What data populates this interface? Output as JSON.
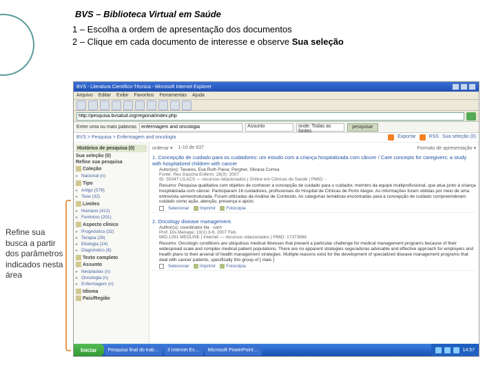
{
  "slide": {
    "title": "BVS – Biblioteca Virtual em Saúde",
    "line1": "1 – Escolha a ordem de apresentação dos documentos",
    "line2_a": "2 – Clique em cada documento de interesse e observe ",
    "line2_b": "Sua seleção"
  },
  "annotation": "Refine sua busca a partir dos parâmetros indicados nesta área",
  "browser": {
    "title": "BVS - Literatura Científico-Técnica - Microsoft Internet Explorer",
    "menu": [
      "Arquivo",
      "Editar",
      "Exibir",
      "Favoritos",
      "Ferramentas",
      "Ajuda"
    ],
    "address": "http://pesquisa.bvsalud.org/regional/index.php",
    "go": "Ir",
    "search": {
      "label": "Entre uma ou mais palavras",
      "value": "enfermagem and oncologia",
      "field": "Assunto",
      "scope": "onde: Todas as fontes",
      "button": "pesquisar"
    },
    "breadcrumb": "BVS > Pesquisa > Enfermagem and oncologia",
    "export": "Exportar",
    "rss": "RSS",
    "selection": "Sua seleção (0)"
  },
  "sidebar": {
    "history": "Histórico de pesquisa (0)",
    "yoursel": "Sua seleção (0)",
    "refine": "Refine sua pesquisa",
    "sections": [
      {
        "h": "Coleção",
        "items": [
          "Nacional (n)"
        ]
      },
      {
        "h": "Tipo",
        "items": [
          "Artigo (579)",
          "Tese (32)"
        ]
      },
      {
        "h": "Limites",
        "items": [
          "Humano (412)",
          "Feminino (201)"
        ]
      },
      {
        "h": "Aspecto clínico",
        "items": [
          "Prognóstico (32)",
          "Terapia (29)",
          "Etiologia (24)",
          "Diagnóstico (8)"
        ]
      },
      {
        "h": "Texto completo",
        "items": []
      },
      {
        "h": "Assunto",
        "items": [
          "Neoplasias (n)",
          "Oncologia (n)",
          "Enfermagem (n)"
        ]
      },
      {
        "h": "Idioma",
        "items": []
      },
      {
        "h": "País/Região",
        "items": []
      }
    ]
  },
  "results": {
    "order": "ordenar ▾",
    "range": "1-10 de 637",
    "format": "Formato de apresentação ▾",
    "items": [
      {
        "n": "1.",
        "title": "Concepção de cuidado para os cuidadores: um estudo com a criança hospitalizada com câncer / Care concepts for caregivers: a study with hospitalized children with cancer",
        "authors": "Autor(es): Tavares, Eva Ruth Paiva; Pergher, Silvana Correa",
        "source": "Fonte: Rev Gaúcha Enferm; 28(3): 2007",
        "id": "ID: 50347 LILACS — recursos relacionados | Online em Clínicas de Saúde | PMID: -",
        "abs": "Resumo: Pesquisa qualitativa com objetivo de conhecer a concepção de cuidado para o cuidador, membro da equipe multiprofissional, que atua junto à criança hospitalizada com câncer. Participaram 16 cuidadores, profissionais do Hospital de Clínicas de Porto Alegre. As informações foram obtidas por meio de uma entrevista semiestruturada. Foram utilizadas da Análise de Conteúdo. As categorias temáticas encontradas para a concepção de cuidado compreenderam: cuidado como ação, atenção, presença e apoio.",
        "actions": {
          "select": "Selecionar",
          "print": "Imprimir",
          "photocopy": "Fotocópia"
        }
      },
      {
        "n": "2.",
        "title": "Oncology disease management.",
        "authors": "Author(s): coordinator lila · corn",
        "source": "Prof. Dis.Manage; 10(1):3-6, 2007 Feb.",
        "id": "MID:1261 MEDLINE | Internet — recursos relacionados | PMID: 17373986",
        "abs": "Resumo: Oncologic conditions are ubiquitous medical illnesses that present a particular challenge for medical management programs because of their widespread scale and complex medical patient populations. There are no apparent strategies seguradoras advisable and effective approach for employers and health plans to their arsenal of health management strategies. Multiple reasons exist for the development of specialized disease management programs that deal with cancer patients, specifically this group of [ mais ]",
        "actions": {
          "select": "Selecionar",
          "print": "Imprimir",
          "photocopy": "Fotocópia"
        }
      }
    ]
  },
  "taskbar": {
    "start": "Iniciar",
    "items": [
      "Pesquisa final do trab…",
      "3 Internet Ex…",
      "Microsoft PowerPoint…"
    ],
    "time": "14:57"
  }
}
